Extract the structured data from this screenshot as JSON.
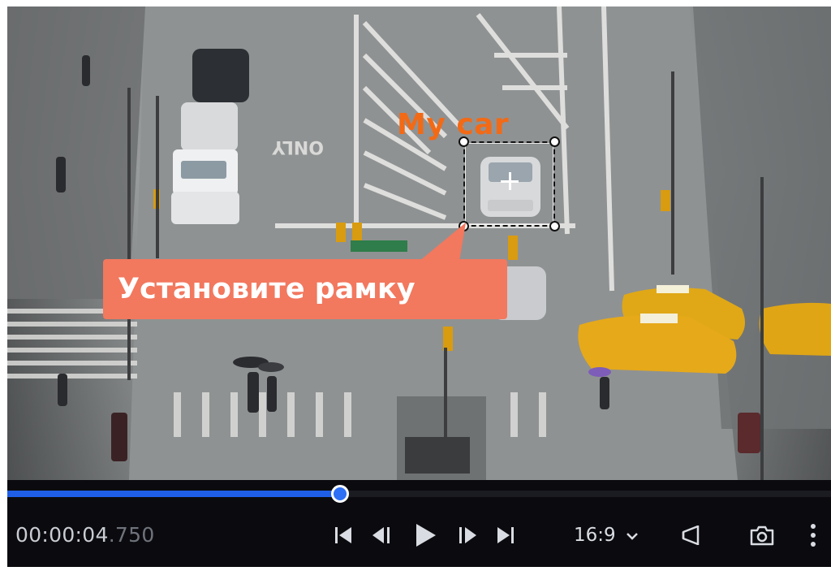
{
  "annotation": {
    "object_label": "My car",
    "object_label_color": "#f26a16"
  },
  "tooltip": {
    "text": "Установите рамку",
    "background_color": "#f2785e"
  },
  "player": {
    "progress_fraction": 0.404,
    "progress_color": "#1f5fe8",
    "time_main": "00:00:04",
    "time_ms": ".750",
    "aspect_ratio": "16:9",
    "icons": [
      "skip-to-start-icon",
      "previous-frame-icon",
      "play-icon",
      "next-frame-icon",
      "skip-to-end-icon",
      "chevron-down-icon",
      "megaphone-icon",
      "camera-icon",
      "more-vertical-icon"
    ]
  }
}
